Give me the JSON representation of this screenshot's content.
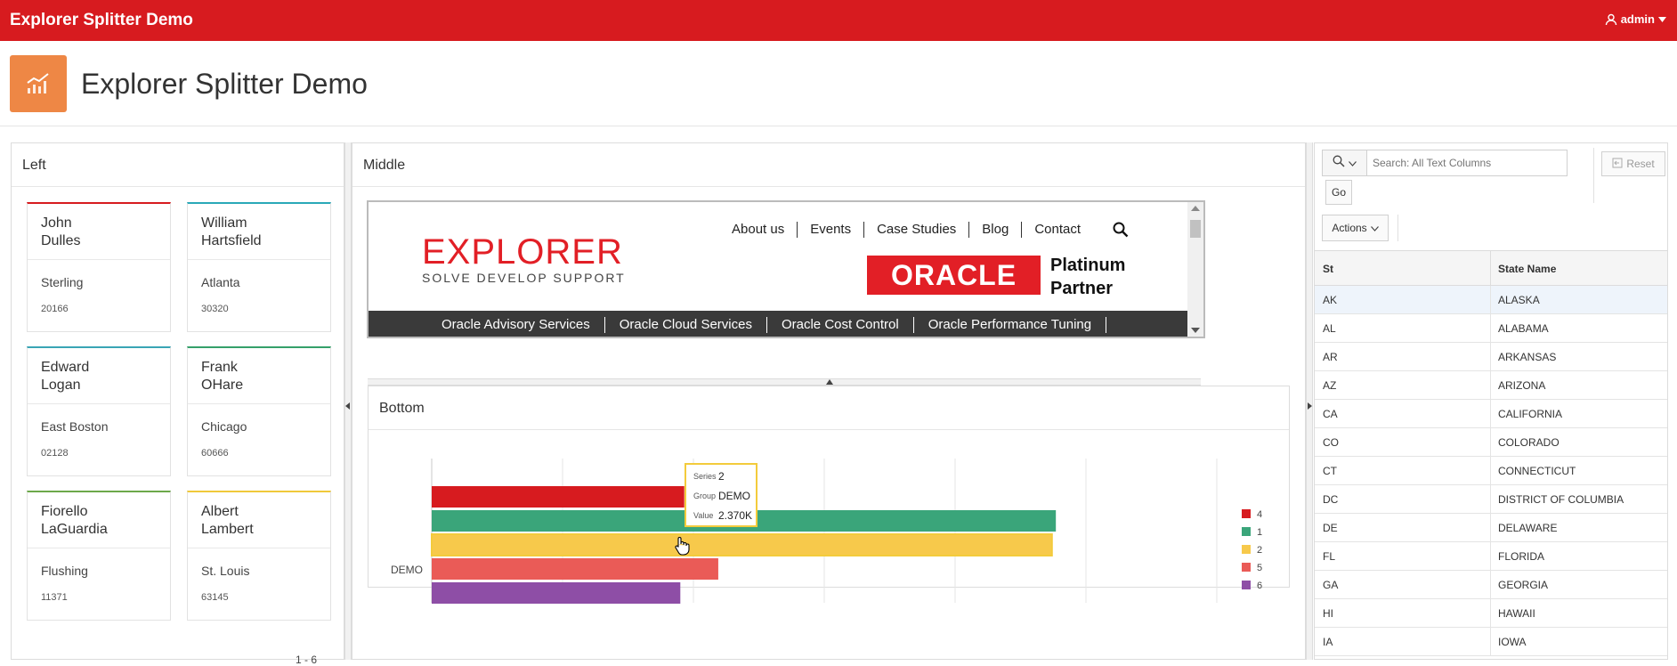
{
  "topbar": {
    "app_title": "Explorer Splitter Demo",
    "user_name": "admin"
  },
  "page": {
    "title": "Explorer Splitter Demo"
  },
  "left": {
    "title": "Left",
    "cards": [
      {
        "name_first": "John",
        "name_last": "Dulles",
        "city": "Sterling",
        "zip": "20166",
        "accent": "#d71b1f"
      },
      {
        "name_first": "William",
        "name_last": "Hartsfield",
        "city": "Atlanta",
        "zip": "30320",
        "accent": "#2aa8b8"
      },
      {
        "name_first": "Edward",
        "name_last": "Logan",
        "city": "East Boston",
        "zip": "02128",
        "accent": "#3aa5b5"
      },
      {
        "name_first": "Frank",
        "name_last": "OHare",
        "city": "Chicago",
        "zip": "60666",
        "accent": "#35a06a"
      },
      {
        "name_first": "Fiorello",
        "name_last": "LaGuardia",
        "city": "Flushing",
        "zip": "11371",
        "accent": "#6ca84a"
      },
      {
        "name_first": "Albert",
        "name_last": "Lambert",
        "city": "St. Louis",
        "zip": "63145",
        "accent": "#f0c93a"
      }
    ],
    "pager": "1 - 6"
  },
  "middle": {
    "title": "Middle",
    "site": {
      "logo_main": "EXPLORER",
      "logo_sub": "SOLVE DEVELOP SUPPORT",
      "nav": [
        "About us",
        "Events",
        "Case Studies",
        "Blog",
        "Contact"
      ],
      "oracle": "ORACLE",
      "platinum_line1": "Platinum",
      "platinum_line2": "Partner",
      "services": [
        "Oracle Advisory Services",
        "Oracle Cloud Services",
        "Oracle Cost Control",
        "Oracle Performance Tuning"
      ]
    }
  },
  "bottom": {
    "title": "Bottom"
  },
  "chart_data": {
    "type": "bar",
    "orientation": "horizontal",
    "categories": [
      "DEMO"
    ],
    "series": [
      {
        "name": "4",
        "values": [
          1930
        ],
        "color": "#d71b1f"
      },
      {
        "name": "1",
        "values": [
          4770
        ],
        "color": "#3aa57a"
      },
      {
        "name": "2",
        "values": [
          4740
        ],
        "color": "#f7c94b"
      },
      {
        "name": "5",
        "values": [
          2190
        ],
        "color": "#ea5b57"
      },
      {
        "name": "6",
        "values": [
          1900
        ],
        "color": "#8e4ea6"
      }
    ],
    "xlim": [
      0,
      6000
    ],
    "grid": true,
    "legend_position": "right",
    "tooltip": {
      "series_label": "Series",
      "series_value": "2",
      "group_label": "Group",
      "group_value": "DEMO",
      "value_label": "Value",
      "value_value": "2.370K"
    }
  },
  "right": {
    "search_placeholder": "Search: All Text Columns",
    "go_label": "Go",
    "reset_label": "Reset",
    "actions_label": "Actions",
    "columns": [
      "St",
      "State Name"
    ],
    "rows": [
      [
        "AK",
        "ALASKA"
      ],
      [
        "AL",
        "ALABAMA"
      ],
      [
        "AR",
        "ARKANSAS"
      ],
      [
        "AZ",
        "ARIZONA"
      ],
      [
        "CA",
        "CALIFORNIA"
      ],
      [
        "CO",
        "COLORADO"
      ],
      [
        "CT",
        "CONNECTICUT"
      ],
      [
        "DC",
        "DISTRICT OF COLUMBIA"
      ],
      [
        "DE",
        "DELAWARE"
      ],
      [
        "FL",
        "FLORIDA"
      ],
      [
        "GA",
        "GEORGIA"
      ],
      [
        "HI",
        "HAWAII"
      ],
      [
        "IA",
        "IOWA"
      ]
    ]
  }
}
